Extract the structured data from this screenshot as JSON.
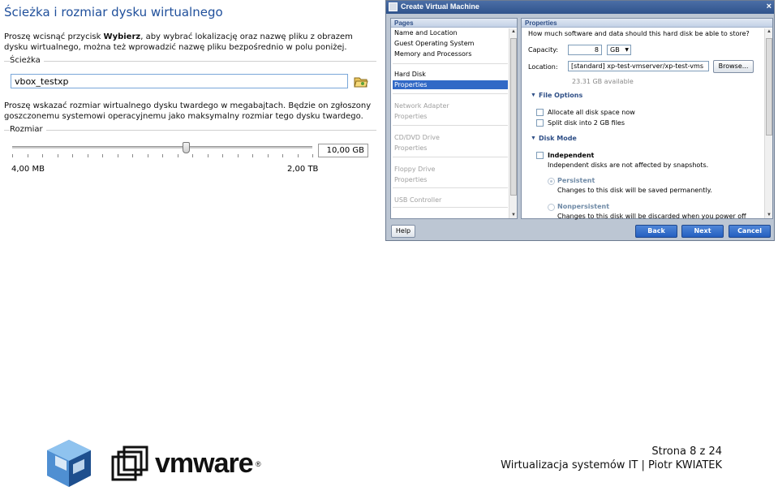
{
  "vbox": {
    "title": "Ścieżka i rozmiar dysku wirtualnego",
    "intro_before": "Proszę wcisnąć przycisk ",
    "intro_bold": "Wybierz",
    "intro_after": ", aby wybrać lokalizację oraz nazwę pliku z obrazem dysku wirtualnego, można też wprowadzić nazwę pliku bezpośrednio w polu poniżej.",
    "path_group": "Ścieżka",
    "path_value": "vbox_testxp",
    "size_desc": "Proszę wskazać rozmiar wirtualnego dysku twardego w megabajtach. Będzie on zgłoszony goszczonemu systemowi operacyjnemu jako maksymalny rozmiar tego dysku twardego.",
    "size_group": "Rozmiar",
    "size_value": "10,00 GB",
    "slider_level": 0.58,
    "min_label": "4,00 MB",
    "max_label": "2,00 TB"
  },
  "vmware": {
    "window_title": "Create Virtual Machine",
    "close": "×",
    "pages_header": "Pages",
    "pages": [
      {
        "label": "Name and Location",
        "state": "normal"
      },
      {
        "label": "Guest Operating System",
        "state": "normal"
      },
      {
        "label": "Memory and Processors",
        "state": "normal"
      },
      {
        "label": "Hard Disk",
        "state": "normal"
      },
      {
        "label": "Properties",
        "state": "selected"
      },
      {
        "label": "Network Adapter",
        "state": "disabled"
      },
      {
        "label": "Properties",
        "state": "disabled"
      },
      {
        "label": "CD/DVD Drive",
        "state": "disabled"
      },
      {
        "label": "Properties",
        "state": "disabled"
      },
      {
        "label": "Floppy Drive",
        "state": "disabled"
      },
      {
        "label": "Properties",
        "state": "disabled"
      },
      {
        "label": "USB Controller",
        "state": "disabled"
      }
    ],
    "props_header": "Properties",
    "question": "How much software and data should this hard disk be able to store?",
    "capacity_label": "Capacity:",
    "capacity_value": "8",
    "capacity_unit": "GB",
    "location_label": "Location:",
    "location_value": "[standard] xp-test-vmserver/xp-test-vms",
    "browse": "Browse...",
    "available": "23.31 GB available",
    "file_options_title": "File Options",
    "opt_allocate": "Allocate all disk space now",
    "opt_split": "Split disk into 2 GB files",
    "disk_mode_title": "Disk Mode",
    "independent": "Independent",
    "independent_desc": "Independent disks are not affected by snapshots.",
    "persistent": "Persistent",
    "persistent_desc": "Changes to this disk will be saved permanently.",
    "nonpersistent": "Nonpersistent",
    "nonpersistent_desc": "Changes to this disk will be discarded when you power off",
    "help": "Help",
    "back": "Back",
    "next": "Next",
    "cancel": "Cancel"
  },
  "footer": {
    "vmware_wordmark": "vmware",
    "registered": "®",
    "page": "Strona 8 z 24",
    "course": "Wirtualizacja systemów IT | Piotr KWIATEK"
  }
}
